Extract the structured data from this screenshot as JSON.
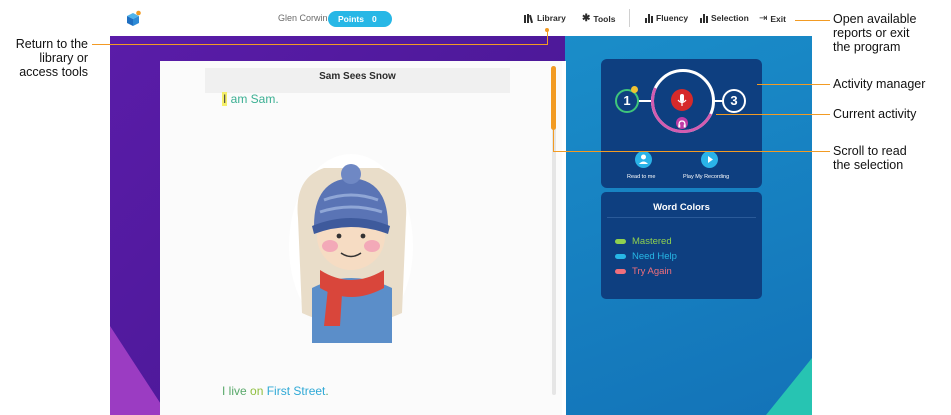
{
  "app": {
    "user_name": "Glen Corwin",
    "points_label": "Points",
    "points_value": "0"
  },
  "toolbar": {
    "library": "Library",
    "tools": "Tools",
    "fluency": "Fluency",
    "selection": "Selection",
    "exit": "Exit"
  },
  "reading": {
    "title": "Sam Sees Snow",
    "line1_highlight": "I",
    "line1_rest": " am Sam.",
    "line2_a": "I live ",
    "line2_b": "on ",
    "line2_c": "First Street",
    "line2_d": "."
  },
  "activity": {
    "step1": "1",
    "step3": "3",
    "read_to_me": "Read to me",
    "play_recording": "Play My Recording"
  },
  "word_colors": {
    "title": "Word Colors",
    "items": [
      {
        "label": "Mastered",
        "color": "#8fd14f"
      },
      {
        "label": "Need Help",
        "color": "#27b7e6"
      },
      {
        "label": "Try Again",
        "color": "#ef6f7c"
      }
    ]
  },
  "callouts": {
    "library_l1": "Return to the",
    "library_l2": "library or",
    "library_l3": "access tools",
    "reports_l1": "Open available",
    "reports_l2": "reports or exit",
    "reports_l3": "the program",
    "activity_manager": "Activity manager",
    "current_activity": "Current activity",
    "scroll_l1": "Scroll to read",
    "scroll_l2": "the selection"
  },
  "colors": {
    "accent_orange": "#f29b23",
    "stage_purple": "#4a1896",
    "stage_blue": "#1373b8",
    "panel_navy": "#0e3f80"
  }
}
